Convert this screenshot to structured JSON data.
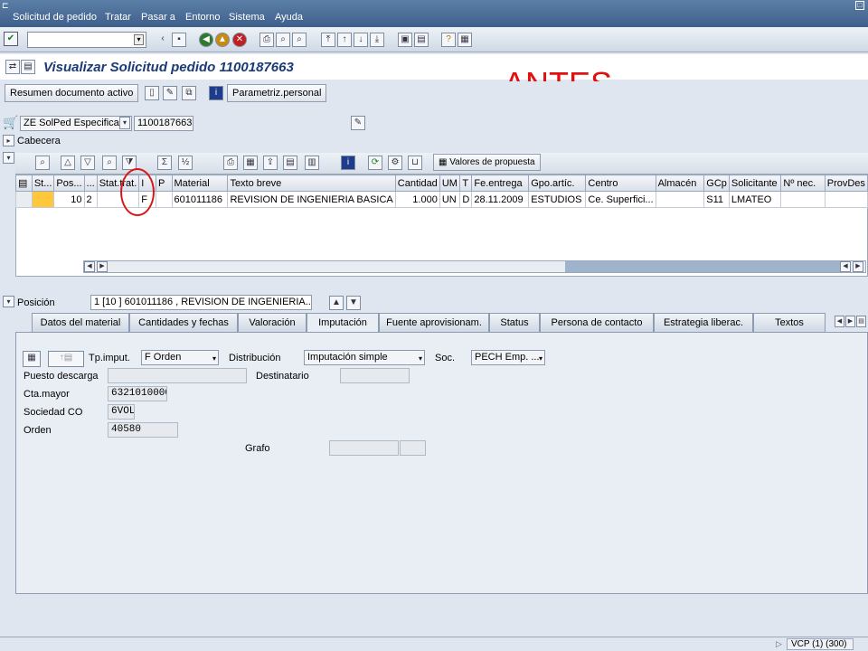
{
  "menu": {
    "items": [
      "Solicitud de pedido",
      "Tratar",
      "Pasar a",
      "Entorno",
      "Sistema",
      "Ayuda"
    ]
  },
  "title": "Visualizar Solicitud pedido 1100187663",
  "annotation": "ANTES",
  "app_toolbar": {
    "summary_label": "Resumen documento activo",
    "personal_label": "Parametriz.personal"
  },
  "header": {
    "doc_type": "ZE SolPed Especifica",
    "doc_number": "1100187663",
    "cabecera_label": "Cabecera"
  },
  "grid_toolbar": {
    "proposal_label": "Valores de propuesta"
  },
  "grid": {
    "columns": [
      "St...",
      "Pos...",
      "...",
      "Stat.trat.",
      "I",
      "P",
      "Material",
      "Texto breve",
      "Cantidad",
      "UM",
      "T",
      "Fe.entrega",
      "Gpo.artíc.",
      "Centro",
      "Almacén",
      "GCp",
      "Solicitante",
      "Nº nec.",
      "ProvDes"
    ],
    "row": [
      "",
      "10",
      "2",
      "",
      "F",
      "",
      "601011186",
      "REVISION DE INGENIERIA BASICA",
      "1.000",
      "UN",
      "D",
      "28.11.2009",
      "ESTUDIOS",
      "Ce. Superfici...",
      "",
      "S11",
      "LMATEO",
      "",
      ""
    ]
  },
  "position": {
    "label": "Posición",
    "value": "1 [10 ] 601011186 , REVISION DE INGENIERIA..."
  },
  "tabs": [
    "Datos del material",
    "Cantidades y fechas",
    "Valoración",
    "Imputación",
    "Fuente aprovisionam.",
    "Status",
    "Persona de contacto",
    "Estrategia liberac.",
    "Textos"
  ],
  "active_tab": "Imputación",
  "imputacion": {
    "tp_imput_label": "Tp.imput.",
    "tp_imput_value": "F Orden",
    "distribucion_label": "Distribución",
    "distribucion_value": "Imputación simple",
    "soc_label": "Soc.",
    "soc_value": "PECH Emp. ...",
    "puesto_label": "Puesto descarga",
    "destinatario_label": "Destinatario",
    "cta_label": "Cta.mayor",
    "cta_value": "6321010000",
    "sociedad_label": "Sociedad CO",
    "sociedad_value": "6VOL",
    "orden_label": "Orden",
    "orden_value": "40580",
    "grafo_label": "Grafo"
  },
  "status": {
    "system": "VCP (1) (300)"
  }
}
